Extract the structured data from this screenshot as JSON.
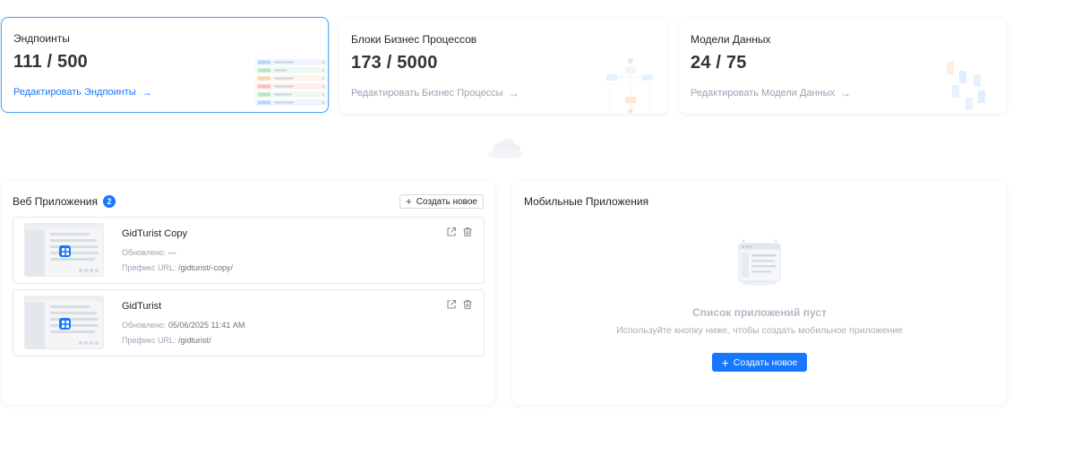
{
  "stats": [
    {
      "title": "Эндпоинты",
      "value": "111 / 500",
      "link": "Редактировать Эндпоинты"
    },
    {
      "title": "Блоки Бизнес Процессов",
      "value": "173 / 5000",
      "link": "Редактировать Бизнес Процессы"
    },
    {
      "title": "Модели Данных",
      "value": "24 / 75",
      "link": "Редактировать Модели Данных"
    }
  ],
  "web_apps": {
    "title": "Веб Приложения",
    "count": "2",
    "create_label": "Создать новое",
    "items": [
      {
        "name": "GidTurist Copy",
        "updated_label": "Обновлено:",
        "updated_value": "—",
        "prefix_label": "Префикс URL:",
        "prefix_value": "/gidturist/-copy/"
      },
      {
        "name": "GidTurist",
        "updated_label": "Обновлено:",
        "updated_value": "05/06/2025 11:41 AM",
        "prefix_label": "Префикс URL:",
        "prefix_value": "/gidturist/"
      }
    ]
  },
  "mobile_apps": {
    "title": "Мобильные Приложения",
    "empty_title": "Список приложений пуст",
    "empty_subtitle": "Используйте кнопку ниже, чтобы создать мобильное приложение",
    "create_label": "Создать новое"
  },
  "colors": {
    "accent": "#1677ff",
    "card_border_active": "#5aa6f3"
  },
  "icons": [
    "arrow-right-icon",
    "plus-icon",
    "external-link-icon",
    "trash-icon",
    "cloud-icon",
    "app-grid-icon",
    "empty-list-icon"
  ]
}
